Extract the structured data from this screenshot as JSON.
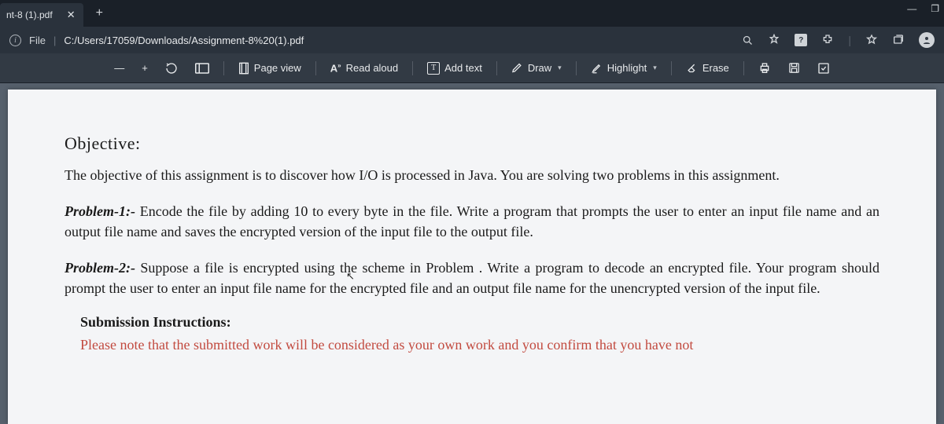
{
  "browser": {
    "tab_title": "nt-8 (1).pdf",
    "file_scheme": "File",
    "url": "C:/Users/17059/Downloads/Assignment-8%20(1).pdf",
    "window_minimize": "—",
    "window_restore": "❐"
  },
  "pdf_toolbar": {
    "page_view": "Page view",
    "read_aloud": "Read aloud",
    "add_text": "Add text",
    "draw": "Draw",
    "highlight": "Highlight",
    "erase": "Erase"
  },
  "document": {
    "objective_heading": "Objective:",
    "objective_body": "The objective of this assignment is to discover how I/O is processed in Java. You are solving two problems in this assignment.",
    "p1_label": "Problem-1:- ",
    "p1_body": "Encode the file by adding 10 to every byte in the file. Write a program that prompts the user to enter an input file name and an output file name and saves the encrypted version of the input file to the output file.",
    "p2_label": "Problem-2:- ",
    "p2_body": "Suppose a file is encrypted using the scheme in Problem . Write a program to decode an encrypted file. Your program should prompt the user to enter an input file name for the encrypted file and an output file name for the unencrypted version of the input file.",
    "submission_heading": "Submission Instructions:",
    "submission_note": "Please note that the submitted work will be considered as your own work and you confirm that you have not"
  }
}
